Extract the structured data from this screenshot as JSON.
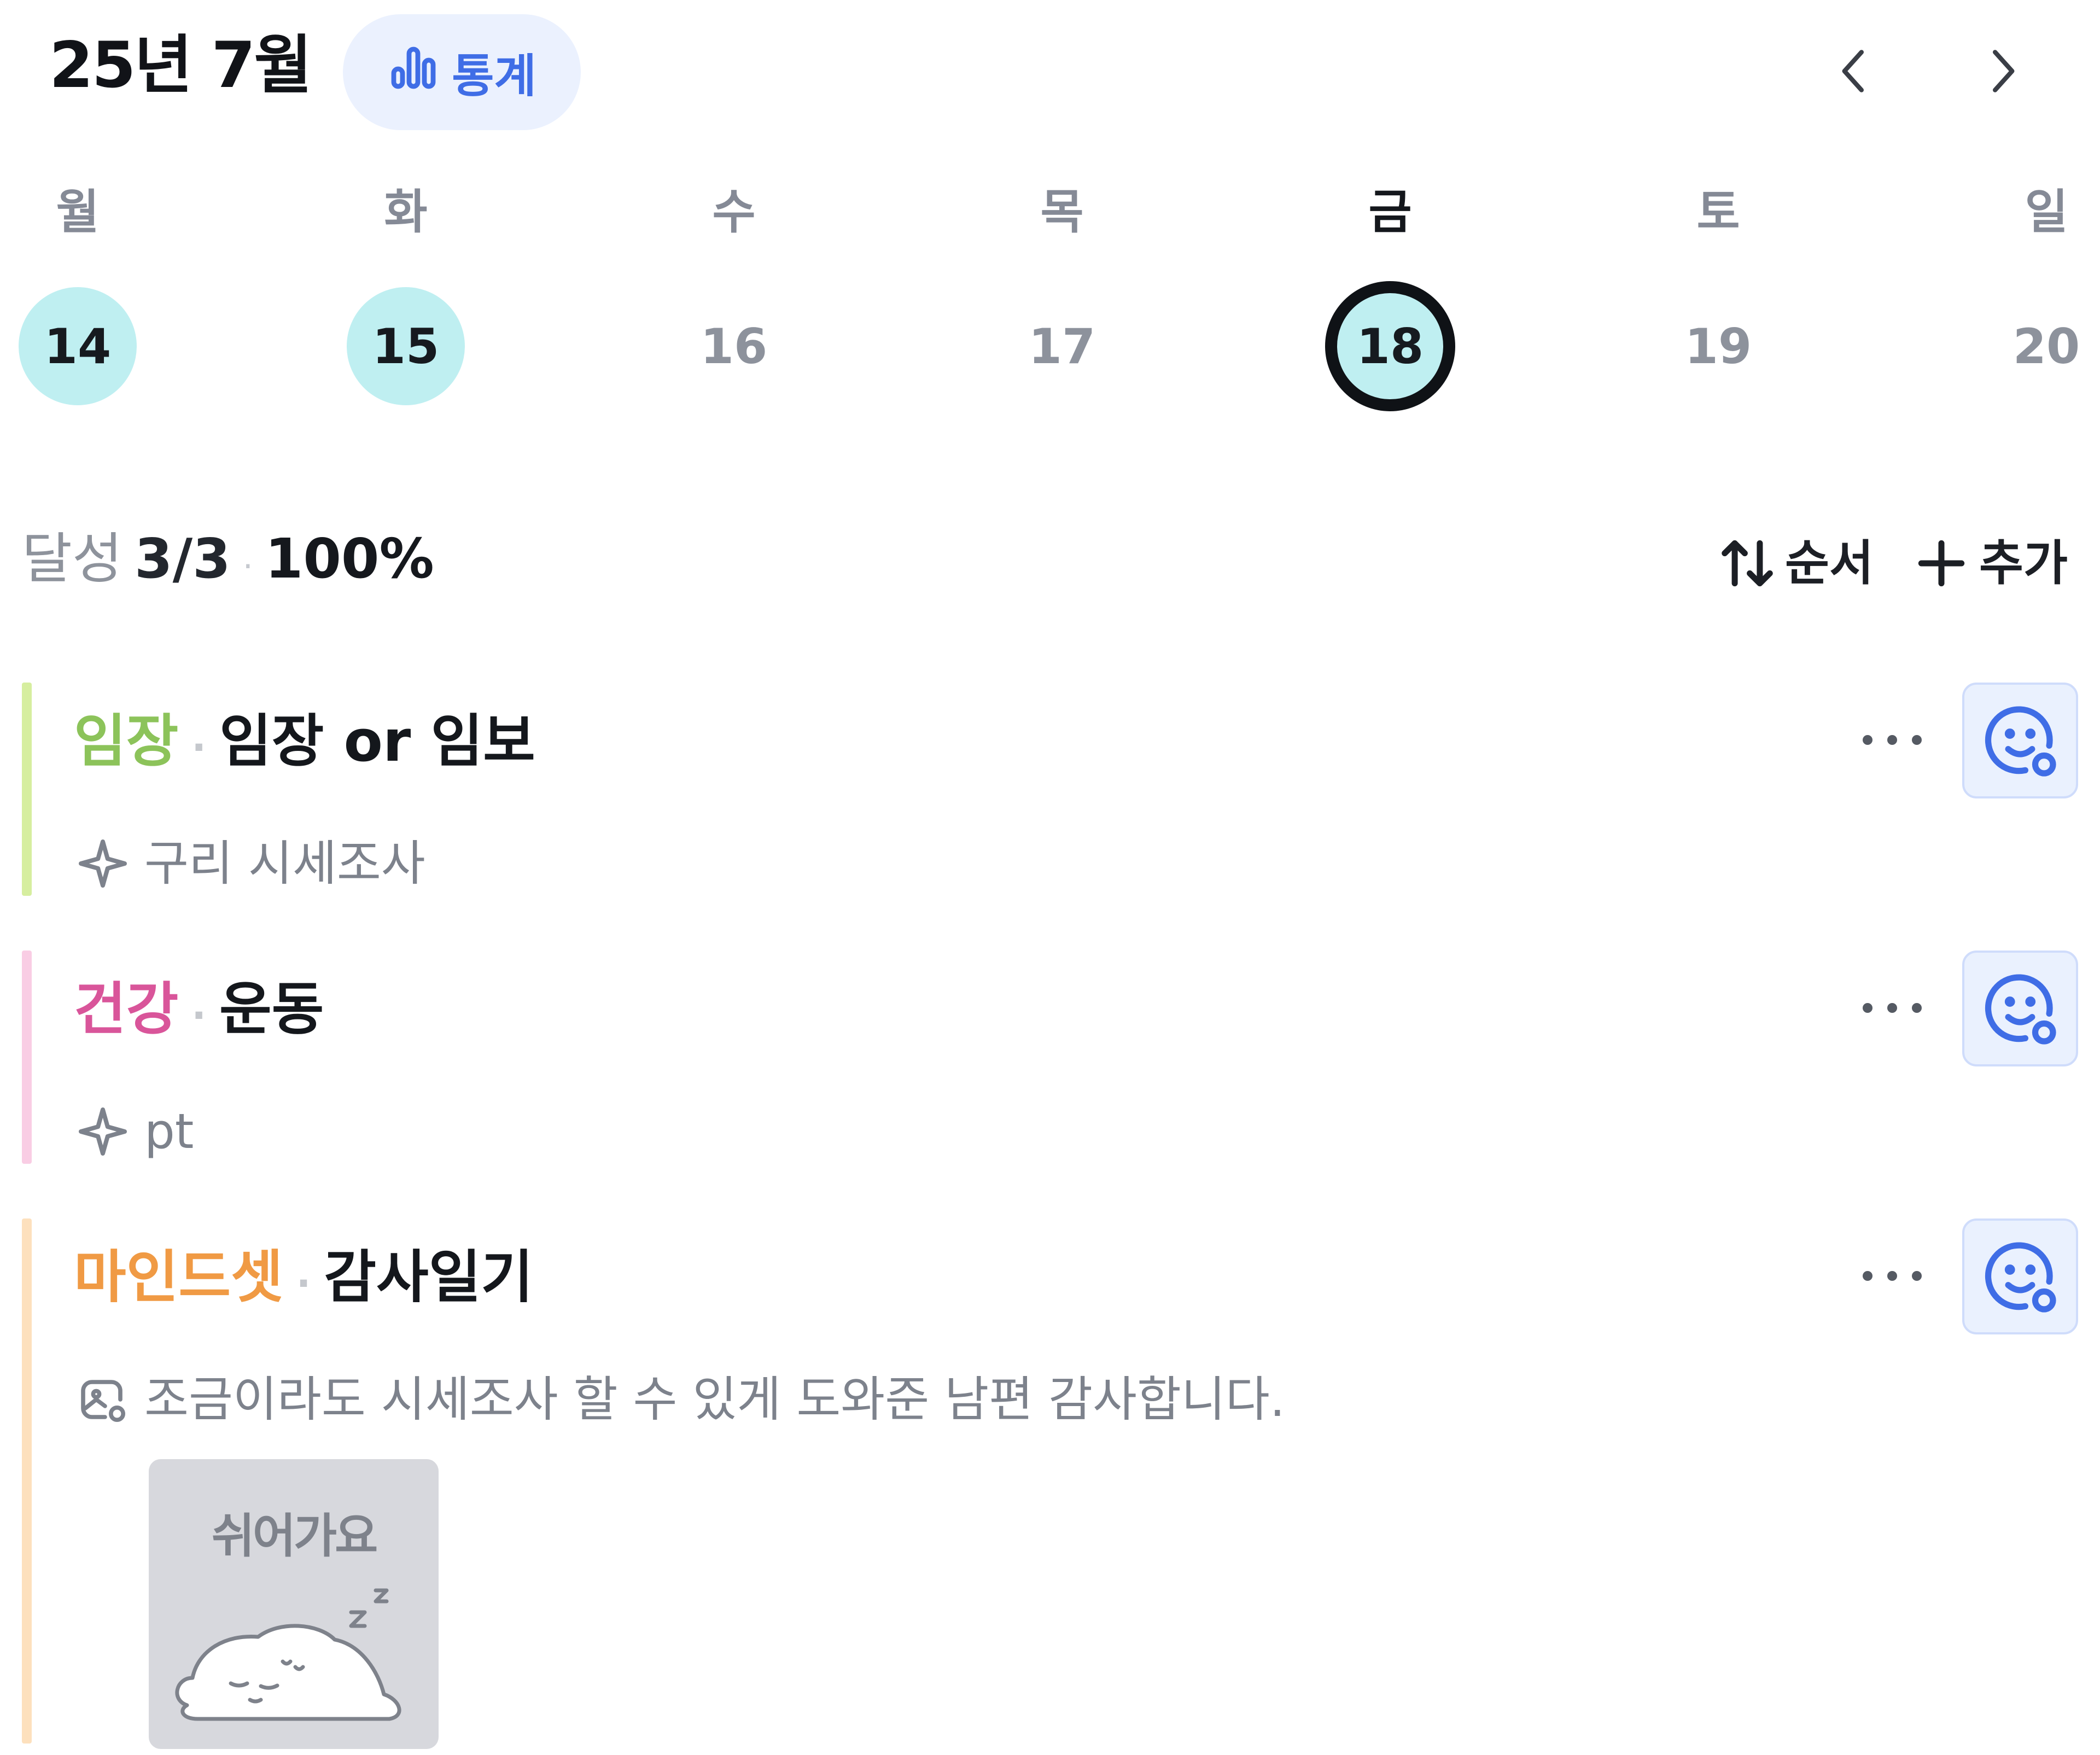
{
  "header": {
    "month_title": "25년 7월",
    "stats_label": "통계",
    "prev_label": "이전 주",
    "next_label": "다음 주"
  },
  "week": {
    "weekdays": [
      "월",
      "화",
      "수",
      "목",
      "금",
      "토",
      "일"
    ],
    "days": [
      "14",
      "15",
      "16",
      "17",
      "18",
      "19",
      "20"
    ],
    "completed_days": [
      "14",
      "15"
    ],
    "selected_day": "18"
  },
  "summary": {
    "label": "달성",
    "count": "3/3",
    "separator": "·",
    "percent": "100%"
  },
  "toolbar": {
    "sort_label": "순서",
    "add_label": "추가"
  },
  "habits": [
    {
      "category": "임장",
      "category_color": "#8cc35a",
      "bar_color": "#d6ee9f",
      "separator": "·",
      "name": "임장 or 임보",
      "sub_icon": "sparkle-icon",
      "sub_text": "구리 시세조사"
    },
    {
      "category": "건강",
      "category_color": "#d9559a",
      "bar_color": "#f9cde4",
      "separator": "·",
      "name": "운동",
      "sub_icon": "sparkle-icon",
      "sub_text": "pt"
    },
    {
      "category": "마인드셋",
      "category_color": "#f09a44",
      "bar_color": "#fde0bd",
      "separator": "·",
      "name": "감사일기",
      "sub_icon": "image-note-icon",
      "sub_text": "조금이라도 시세조사 할 수 있게 도와준 남편 감사합니다.",
      "sticker_text": "쉬어가요"
    }
  ],
  "colors": {
    "accent_blue": "#3f6de6",
    "stats_bg": "#ebf1fe",
    "day_done_bg": "#bfeff1",
    "mood_bg": "#eaf1fe"
  }
}
